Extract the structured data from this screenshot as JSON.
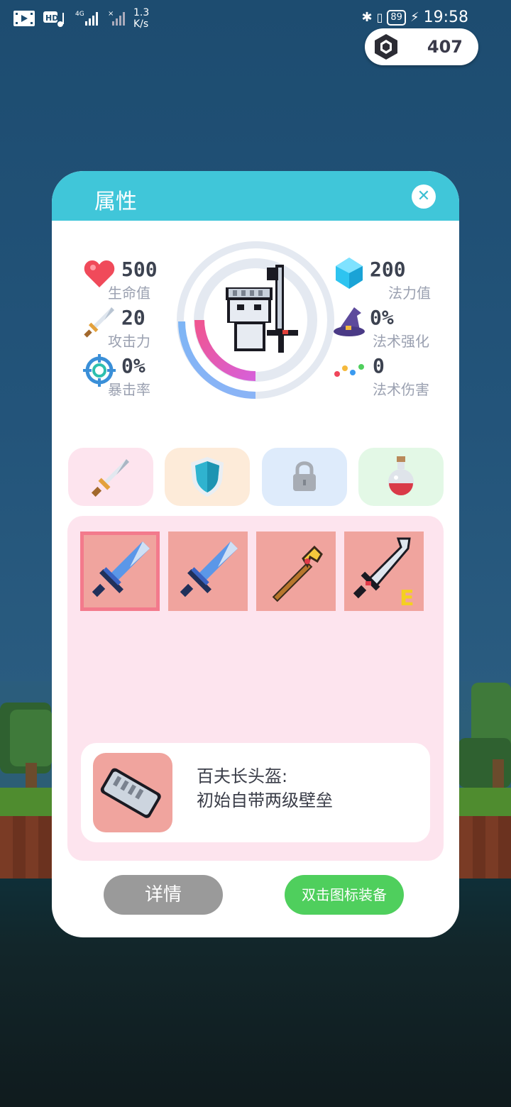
{
  "status_bar": {
    "speed_value": "1.3",
    "speed_unit": "K/s",
    "network": "4G",
    "hd_label": "HD",
    "battery": "89",
    "time": "19:58"
  },
  "currency": {
    "gems": "407",
    "icon": "gem-icon"
  },
  "panel": {
    "title": "属性",
    "close_label": "✕",
    "stats_left": [
      {
        "value": "500",
        "label": "生命值",
        "icon": "heart-icon"
      },
      {
        "value": "20",
        "label": "攻击力",
        "icon": "sword-icon"
      },
      {
        "value": "0%",
        "label": "暴击率",
        "icon": "crosshair-icon"
      }
    ],
    "stats_right": [
      {
        "value": "200",
        "label": "法力值",
        "icon": "crystal-icon"
      },
      {
        "value": "0%",
        "label": "法术强化",
        "icon": "wizard-hat-icon"
      },
      {
        "value": "0",
        "label": "法术伤害",
        "icon": "dots-icon"
      }
    ],
    "tabs": [
      {
        "name": "weapon",
        "icon": "sword-icon",
        "color": "#fde4ee"
      },
      {
        "name": "armor",
        "icon": "shield-icon",
        "color": "#fdebd9"
      },
      {
        "name": "locked",
        "icon": "lock-icon",
        "color": "#deebfb"
      },
      {
        "name": "potion",
        "icon": "potion-icon",
        "color": "#e3f8e6"
      }
    ],
    "inventory": [
      {
        "icon": "blue-sword-icon",
        "selected": true
      },
      {
        "icon": "blue-sword-icon",
        "selected": false
      },
      {
        "icon": "golden-staff-icon",
        "selected": false
      },
      {
        "icon": "broken-blade-icon",
        "selected": false,
        "badge": "E"
      }
    ],
    "item_info": {
      "icon": "helmet-icon",
      "line1": "百夫长头盔:",
      "line2": "初始自带两级壁垒"
    },
    "detail_button": "详情",
    "equip_button": "双击图标装备"
  }
}
